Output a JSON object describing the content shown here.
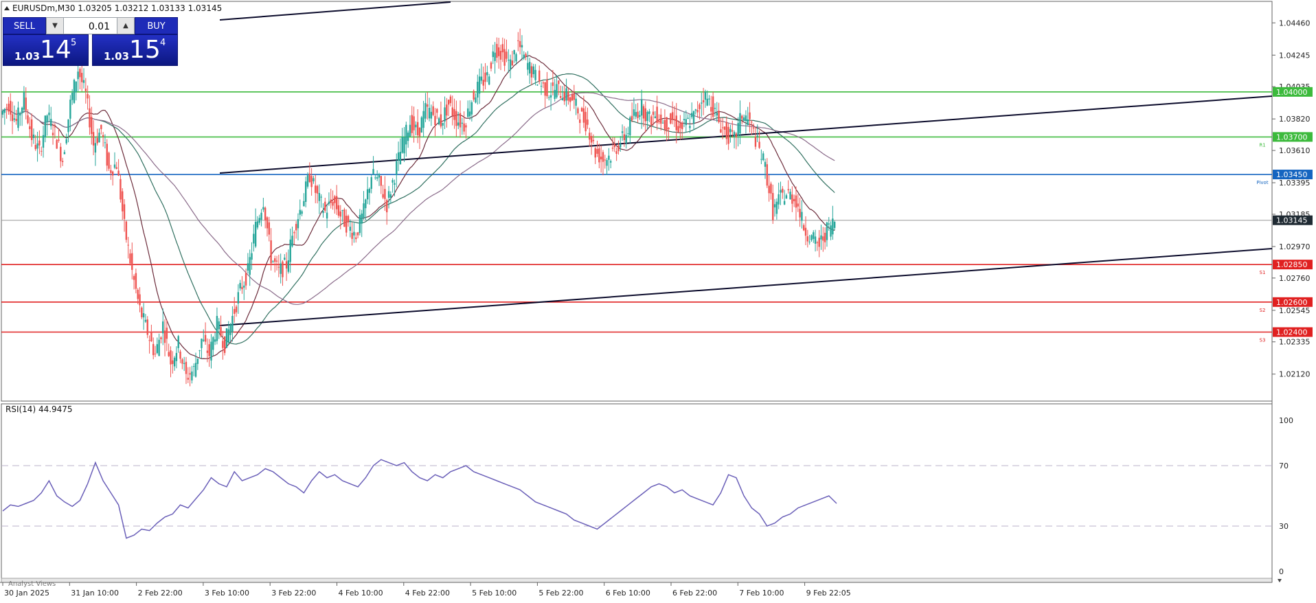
{
  "header": {
    "symbol_info": "EURUSDm,M30  1.03205 1.03212 1.03133 1.03145"
  },
  "trade_panel": {
    "sell_label": "SELL",
    "buy_label": "BUY",
    "lot_value": "0.01",
    "sell_price_small": "1.03",
    "sell_price_big": "14",
    "sell_price_sup": "5",
    "buy_price_small": "1.03",
    "buy_price_big": "15",
    "buy_price_sup": "4"
  },
  "price_axis": {
    "labels": [
      "1.04460",
      "1.04245",
      "1.04035",
      "1.03820",
      "1.03610",
      "1.03395",
      "1.03185",
      "1.02970",
      "1.02760",
      "1.02545",
      "1.02335",
      "1.02120"
    ]
  },
  "levels": [
    {
      "price": 1.04,
      "label": "1.04000",
      "color": "#3cba3c",
      "tag": ""
    },
    {
      "price": 1.037,
      "label": "1.03700",
      "color": "#3cba3c",
      "tag": "R1"
    },
    {
      "price": 1.0345,
      "label": "1.03450",
      "color": "#1565c0",
      "tag": "Pivot"
    },
    {
      "price": 1.0285,
      "label": "1.02850",
      "color": "#e02020",
      "tag": "S1"
    },
    {
      "price": 1.026,
      "label": "1.02600",
      "color": "#e02020",
      "tag": "S2"
    },
    {
      "price": 1.024,
      "label": "1.02400",
      "color": "#e02020",
      "tag": "S3"
    }
  ],
  "current_price": {
    "price": 1.03145,
    "label": "1.03145"
  },
  "rsi": {
    "title": "RSI(14) 44.9475",
    "axis_labels": [
      "100",
      "70",
      "30",
      "0"
    ],
    "levels": [
      70,
      30
    ]
  },
  "time_axis": {
    "labels": [
      "30 Jan 2025",
      "31 Jan 10:00",
      "2 Feb 22:00",
      "3 Feb 10:00",
      "3 Feb 22:00",
      "4 Feb 10:00",
      "4 Feb 22:00",
      "5 Feb 10:00",
      "5 Feb 22:00",
      "6 Feb 10:00",
      "6 Feb 22:00",
      "7 Feb 10:00",
      "9 Feb 22:05"
    ]
  },
  "bottom_tab": "Analyst Views",
  "colors": {
    "bull": "#26a69a",
    "bear": "#ef5350",
    "trendline": "#0a0a2a",
    "rsi_line": "#6a5fb8"
  },
  "chart_data": {
    "type": "candlestick",
    "symbol": "EURUSDm",
    "timeframe": "M30",
    "x_range_labels": [
      "30 Jan 2025",
      "9 Feb 22:05"
    ],
    "ylim": [
      1.0205,
      1.0453
    ],
    "close_path": [
      1.0385,
      1.0392,
      1.038,
      1.0395,
      1.037,
      1.036,
      1.0385,
      1.0372,
      1.0355,
      1.0392,
      1.0415,
      1.0398,
      1.0365,
      1.0375,
      1.0348,
      1.0352,
      1.031,
      1.028,
      1.0255,
      1.024,
      1.0225,
      1.0245,
      1.022,
      1.0232,
      1.021,
      1.0215,
      1.0235,
      1.0225,
      1.0245,
      1.0232,
      1.025,
      1.0268,
      1.028,
      1.031,
      1.0328,
      1.029,
      1.028,
      1.0285,
      1.031,
      1.0325,
      1.0345,
      1.033,
      1.032,
      1.0328,
      1.0318,
      1.031,
      1.0305,
      1.032,
      1.0345,
      1.034,
      1.0325,
      1.0345,
      1.0365,
      1.038,
      1.0372,
      1.0388,
      1.0385,
      1.038,
      1.0392,
      1.0382,
      1.0378,
      1.0395,
      1.0405,
      1.041,
      1.043,
      1.0425,
      1.0418,
      1.0432,
      1.042,
      1.0412,
      1.0405,
      1.04,
      1.0402,
      1.0398,
      1.0395,
      1.0385,
      1.0378,
      1.036,
      1.0355,
      1.0358,
      1.0365,
      1.0372,
      1.0385,
      1.039,
      1.0382,
      1.0385,
      1.0378,
      1.0382,
      1.0375,
      1.038,
      1.0385,
      1.0398,
      1.0392,
      1.038,
      1.0372,
      1.0368,
      1.0385,
      1.038,
      1.0365,
      1.035,
      1.032,
      1.033,
      1.0332,
      1.0328,
      1.031,
      1.0302,
      1.0298,
      1.0308,
      1.0314
    ],
    "reference_levels": [
      1.04,
      1.037,
      1.0345,
      1.0285,
      1.026,
      1.024
    ],
    "current_price": 1.03145,
    "rsi_period": 14,
    "rsi_value": 44.9475,
    "rsi_ylim": [
      0,
      100
    ],
    "rsi_path": [
      40,
      44,
      43,
      45,
      47,
      52,
      60,
      50,
      46,
      43,
      47,
      58,
      72,
      60,
      52,
      44,
      22,
      24,
      28,
      27,
      32,
      36,
      38,
      44,
      42,
      48,
      54,
      62,
      58,
      56,
      66,
      60,
      62,
      64,
      68,
      66,
      62,
      58,
      56,
      52,
      60,
      66,
      62,
      64,
      60,
      58,
      56,
      62,
      70,
      74,
      72,
      70,
      72,
      66,
      62,
      60,
      64,
      62,
      66,
      68,
      70,
      66,
      64,
      62,
      60,
      58,
      56,
      54,
      50,
      46,
      44,
      42,
      40,
      38,
      34,
      32,
      30,
      28,
      32,
      36,
      40,
      44,
      48,
      52,
      56,
      58,
      56,
      52,
      54,
      50,
      48,
      46,
      44,
      52,
      64,
      62,
      50,
      42,
      38,
      30,
      32,
      36,
      38,
      42,
      44,
      46,
      48,
      50,
      45
    ]
  }
}
